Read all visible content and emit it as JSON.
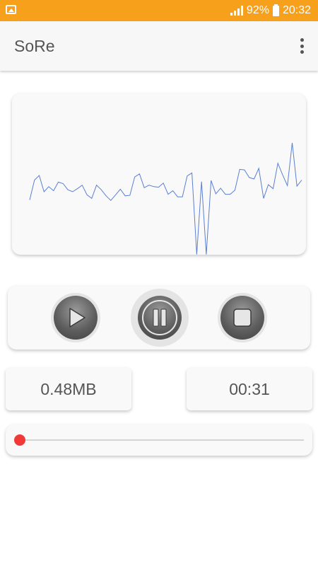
{
  "status_bar": {
    "battery_percent": "92%",
    "time": "20:32",
    "icons": [
      "image-notification-icon",
      "signal-icon",
      "battery-icon"
    ],
    "background_color": "#f6a01c"
  },
  "app_bar": {
    "title": "SoRe",
    "menu_icon": "overflow-menu-icon"
  },
  "waveform": {
    "line_color": "#5b7fd0",
    "samples": [
      0.27,
      0.66,
      0.75,
      0.43,
      0.53,
      0.45,
      0.62,
      0.59,
      0.47,
      0.43,
      0.49,
      0.56,
      0.37,
      0.3,
      0.56,
      0.47,
      0.35,
      0.26,
      0.37,
      0.48,
      0.35,
      0.36,
      0.72,
      0.78,
      0.51,
      0.56,
      0.53,
      0.52,
      0.6,
      0.38,
      0.45,
      0.33,
      0.33,
      0.74,
      0.8,
      -0.8,
      0.63,
      -0.8,
      0.65,
      0.39,
      0.5,
      0.38,
      0.38,
      0.46,
      0.87,
      0.86,
      0.71,
      0.68,
      0.89,
      0.3,
      0.57,
      0.49,
      0.99,
      0.76,
      0.55,
      1.39,
      0.54,
      0.66
    ]
  },
  "controls": {
    "play_icon": "play-icon",
    "pause_icon": "pause-icon",
    "stop_icon": "stop-icon",
    "active": "pause"
  },
  "info": {
    "file_size": "0.48MB",
    "duration": "00:31"
  },
  "seek": {
    "progress": 0.0,
    "thumb_color": "#f03a3a"
  }
}
